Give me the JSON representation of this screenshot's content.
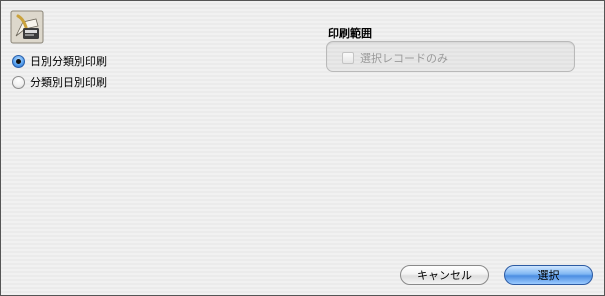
{
  "app": {
    "icon": "print-settings-icon"
  },
  "print_order": {
    "options": [
      {
        "label": "日別分類別印刷",
        "selected": true
      },
      {
        "label": "分類別日別印刷",
        "selected": false
      }
    ]
  },
  "print_range": {
    "title": "印刷範囲",
    "selected_only_label": "選択レコードのみ",
    "selected_only_checked": false,
    "selected_only_enabled": false
  },
  "buttons": {
    "cancel_label": "キャンセル",
    "select_label": "選択"
  }
}
